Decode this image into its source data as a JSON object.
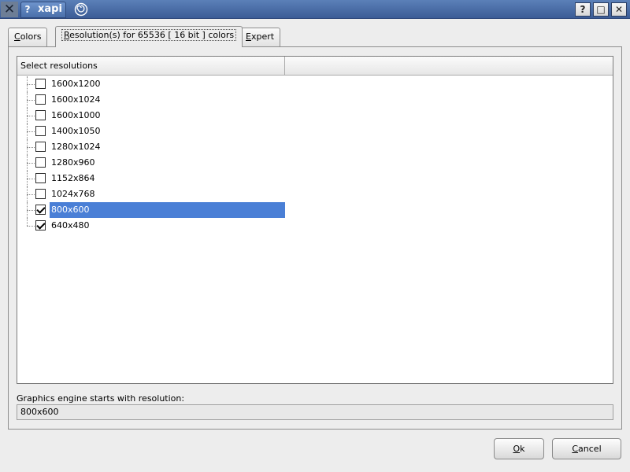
{
  "window": {
    "title": "xapi",
    "help_glyph": "?",
    "controls": {
      "help": "?",
      "maximize": "□",
      "close": "✕"
    }
  },
  "tabs": [
    {
      "label": "Colors",
      "mnemonic": "C",
      "rest": "olors",
      "active": false
    },
    {
      "label": "Resolution(s) for 65536 [ 16 bit ] colors",
      "mnemonic": "R",
      "rest": "esolution(s) for 65536 [ 16 bit ] colors",
      "active": true
    },
    {
      "label": "Expert",
      "mnemonic": "E",
      "rest": "xpert",
      "active": false
    }
  ],
  "list": {
    "header": "Select resolutions",
    "items": [
      {
        "label": "1600x1200",
        "checked": false,
        "selected": false
      },
      {
        "label": "1600x1024",
        "checked": false,
        "selected": false
      },
      {
        "label": "1600x1000",
        "checked": false,
        "selected": false
      },
      {
        "label": "1400x1050",
        "checked": false,
        "selected": false
      },
      {
        "label": "1280x1024",
        "checked": false,
        "selected": false
      },
      {
        "label": "1280x960",
        "checked": false,
        "selected": false
      },
      {
        "label": "1152x864",
        "checked": false,
        "selected": false
      },
      {
        "label": "1024x768",
        "checked": false,
        "selected": false
      },
      {
        "label": "800x600",
        "checked": true,
        "selected": true
      },
      {
        "label": "640x480",
        "checked": true,
        "selected": false
      }
    ]
  },
  "engine": {
    "label": "Graphics engine starts with resolution:",
    "value": "800x600"
  },
  "buttons": {
    "ok": {
      "label": "Ok",
      "mnemonic": "O",
      "rest": "k"
    },
    "cancel": {
      "label": "Cancel",
      "mnemonic": "C",
      "rest": "ancel"
    }
  },
  "colors": {
    "selection": "#4a7fd6",
    "titlebar": "#4a6faa"
  }
}
